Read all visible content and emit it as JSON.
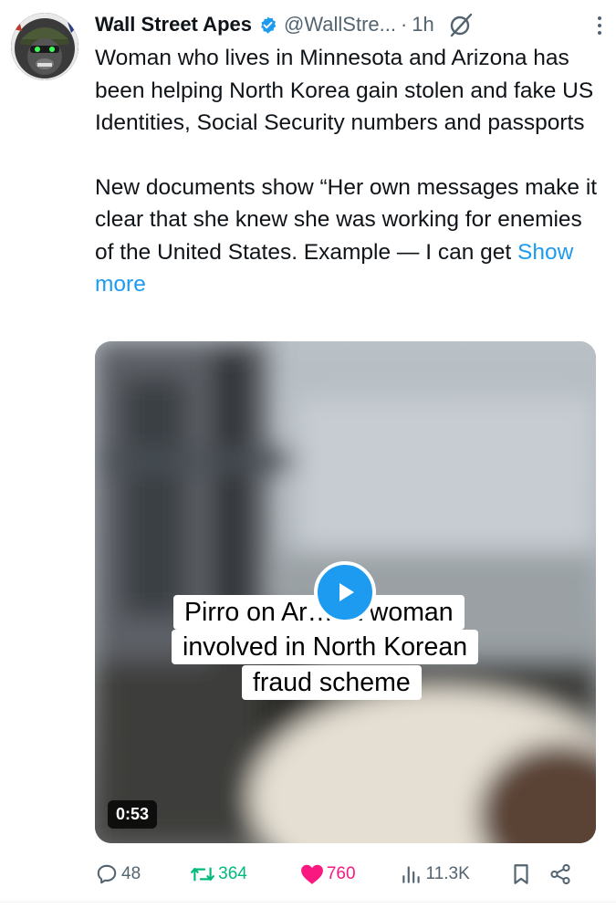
{
  "colors": {
    "accent": "#1d9bf0",
    "text_primary": "#0f1419",
    "text_secondary": "#536471",
    "repost": "#00ba7c",
    "like": "#f91880"
  },
  "author": {
    "name": "Wall Street Apes",
    "handle": "@WallStre...",
    "separator": "·",
    "time": "1h",
    "verified_icon": "verified-badge-icon",
    "avatar": "gorilla-soldier-avatar"
  },
  "tweet": {
    "paragraph1": "Woman who lives in Minnesota and Arizona has been helping North Korea gain stolen and fake US Identities, Social Security numbers and passports",
    "paragraph2": "New documents show “Her own messages make it clear that she knew she was working for enemies of the United States. Example — I can get ",
    "show_more": "Show more"
  },
  "media": {
    "caption_lines": [
      "Pirro on Ar…na woman",
      "involved in North Korean",
      "fraud scheme"
    ],
    "duration": "0:53",
    "play_icon": "play-icon"
  },
  "actions": {
    "replies": "48",
    "reposts": "364",
    "likes": "760",
    "views": "11.3K",
    "icons": [
      "reply-icon",
      "repost-icon",
      "heart-icon",
      "views-icon",
      "bookmark-icon",
      "share-icon"
    ]
  }
}
